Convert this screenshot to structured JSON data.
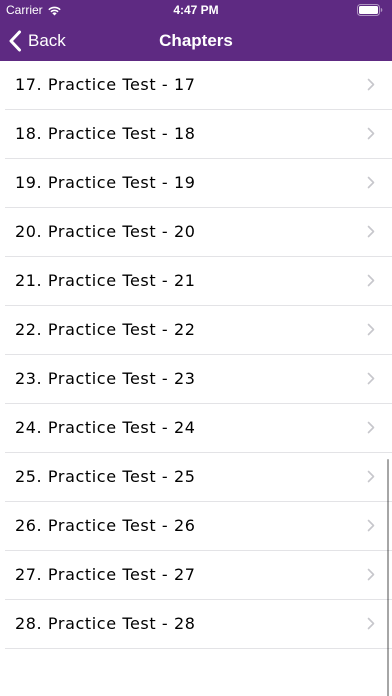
{
  "status_bar": {
    "carrier": "Carrier",
    "time": "4:47 PM"
  },
  "nav": {
    "back_label": "Back",
    "title": "Chapters"
  },
  "colors": {
    "header_bg": "#5e2a82",
    "chevron": "#c7c7cc",
    "separator": "#e3e3e6"
  },
  "chapters": [
    {
      "label": "17. Practice Test - 17"
    },
    {
      "label": "18. Practice Test - 18"
    },
    {
      "label": "19. Practice Test - 19"
    },
    {
      "label": "20. Practice Test - 20"
    },
    {
      "label": "21. Practice Test - 21"
    },
    {
      "label": "22. Practice Test - 22"
    },
    {
      "label": "23. Practice Test - 23"
    },
    {
      "label": "24. Practice Test - 24"
    },
    {
      "label": "25. Practice Test - 25"
    },
    {
      "label": "26. Practice Test - 26"
    },
    {
      "label": "27. Practice Test - 27"
    },
    {
      "label": "28. Practice Test - 28"
    }
  ]
}
